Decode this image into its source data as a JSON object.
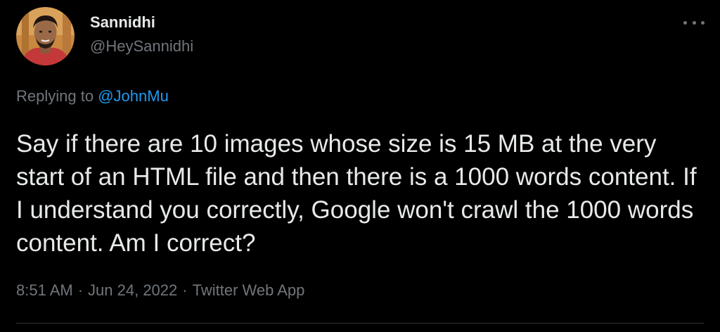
{
  "author": {
    "display_name": "Sannidhi",
    "handle": "@HeySannidhi"
  },
  "reply": {
    "prefix": "Replying to",
    "mention": "@JohnMu"
  },
  "tweet": {
    "text": "Say if there are 10 images whose size is 15 MB at the very start of an HTML file and then there is a 1000 words content. If I understand you correctly, Google won't crawl the 1000 words content. Am I correct?"
  },
  "meta": {
    "time": "8:51 AM",
    "separator": "·",
    "date": "Jun 24, 2022",
    "source": "Twitter Web App"
  },
  "icons": {
    "more": "more-horizontal-icon"
  },
  "colors": {
    "background": "#000000",
    "primary_text": "#e7e9ea",
    "secondary_text": "#71767b",
    "link": "#1d9bf0"
  }
}
